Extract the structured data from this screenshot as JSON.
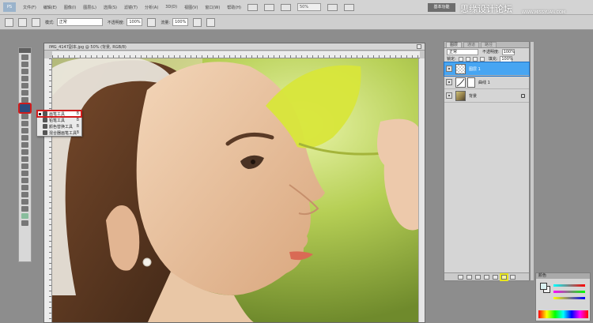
{
  "menu_bar": {
    "logo": "PS",
    "items": [
      "文件(F)",
      "编辑(E)",
      "图像(I)",
      "图层(L)",
      "选择(S)",
      "滤镜(T)",
      "分析(A)",
      "3D(D)",
      "视图(V)",
      "窗口(W)",
      "帮助(H)"
    ],
    "zoom": "50%",
    "workspace_button": "基本功能"
  },
  "watermark": {
    "text": "思缘设计论坛",
    "url": "WWW.MISSYUAN.COM"
  },
  "options_bar": {
    "mode_label": "模式:",
    "mode_value": "正常",
    "opacity_label": "不透明度:",
    "opacity_value": "100%",
    "flow_label": "流量:",
    "flow_value": "100%"
  },
  "document": {
    "title": "IMG_4147副本.jpg @ 50% (背景, RGB/8)"
  },
  "tool_flyout": {
    "items": [
      {
        "label": "画笔工具",
        "key": "B",
        "active": true
      },
      {
        "label": "铅笔工具",
        "key": "B",
        "active": false
      },
      {
        "label": "颜色替换工具",
        "key": "B",
        "active": false
      },
      {
        "label": "混合器画笔工具",
        "key": "B",
        "active": false
      }
    ]
  },
  "layers_panel": {
    "tabs": [
      "图层",
      "通道",
      "路径"
    ],
    "blend_mode": "正常",
    "opacity_label": "不透明度:",
    "opacity_value": "100%",
    "lock_label": "锁定:",
    "fill_label": "填充:",
    "fill_value": "100%",
    "layers": [
      {
        "name": "图层 1",
        "thumb": "transparent",
        "selected": true
      },
      {
        "name": "曲线 1",
        "thumb": "curves",
        "selected": false
      },
      {
        "name": "背景",
        "thumb": "photo",
        "selected": false,
        "locked": true
      }
    ]
  },
  "color_panel": {
    "title": "颜色"
  },
  "colors": {
    "selection_highlight": "#d01c1c",
    "layer_selected": "#47a5f2",
    "button_highlight": "#e7e51d"
  }
}
